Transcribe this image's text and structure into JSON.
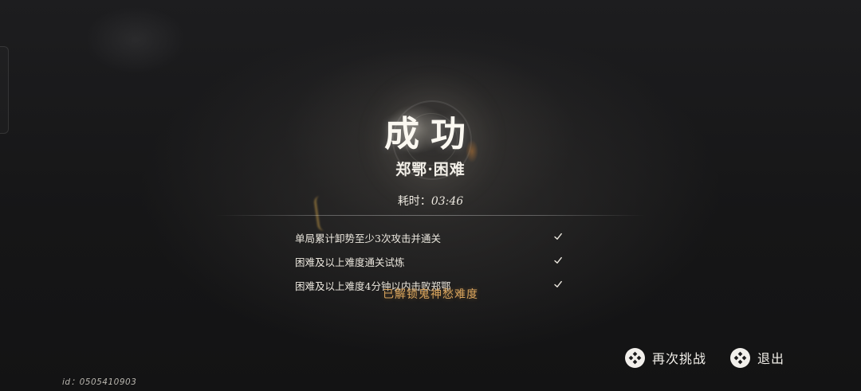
{
  "result": {
    "title": "成功",
    "stage": "郑鄂·困难",
    "time_label": "耗时：",
    "time_value": "03:46"
  },
  "objectives": [
    {
      "text": "单局累计卸势至少3次攻击并通关",
      "completed": true
    },
    {
      "text": "困难及以上难度通关试炼",
      "completed": true
    },
    {
      "text": "困难及以上难度4分钟以内击败郑鄂",
      "completed": true
    }
  ],
  "unlock_notice": "已解锁鬼神愁难度",
  "buttons": {
    "retry_label": "再次挑战",
    "exit_label": "退出"
  },
  "footer": {
    "user_id": "id：0505410903"
  },
  "colors": {
    "unlock_text": "#d7a35c",
    "background": "#1a1a1b",
    "text": "#ece8df"
  },
  "icons": {
    "objective_status": "checkmark-icon",
    "button_glyph": "diamond-dots-icon"
  }
}
